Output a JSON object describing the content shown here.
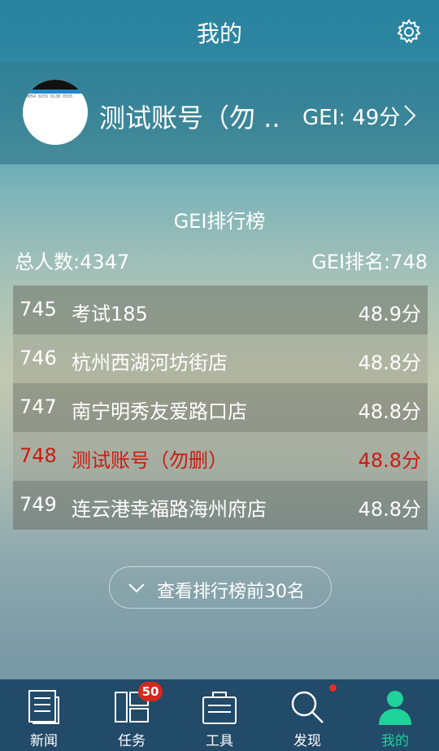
{
  "header": {
    "title": "我的",
    "settings_icon": "gear-icon"
  },
  "profile": {
    "name": "测试账号（勿 ..",
    "gei": "GEI: 49分",
    "avatar_text": "0054 0255 0138 0555"
  },
  "ranking": {
    "title": "GEI排行榜",
    "total": "总人数:4347",
    "my_rank": "GEI排名:748",
    "rows": [
      {
        "rank": "745",
        "name": "考试185",
        "score": "48.9分",
        "highlight": false
      },
      {
        "rank": "746",
        "name": "杭州西湖河坊街店",
        "score": "48.8分",
        "highlight": false
      },
      {
        "rank": "747",
        "name": "南宁明秀友爱路口店",
        "score": "48.8分",
        "highlight": false
      },
      {
        "rank": "748",
        "name": "测试账号（勿删）",
        "score": "48.8分",
        "highlight": true
      },
      {
        "rank": "749",
        "name": "连云港幸福路海州府店",
        "score": "48.8分",
        "highlight": false
      }
    ],
    "view_more": "查看排行榜前30名"
  },
  "tabbar": {
    "items": [
      {
        "label": "新闻",
        "icon": "news-icon"
      },
      {
        "label": "任务",
        "icon": "tasks-icon",
        "badge": "50"
      },
      {
        "label": "工具",
        "icon": "toolbox-icon"
      },
      {
        "label": "发现",
        "icon": "search-icon"
      },
      {
        "label": "我的",
        "icon": "user-icon",
        "active": true
      }
    ]
  },
  "colors": {
    "highlight": "#cc1a12",
    "active_tab": "#1ed29a",
    "tabbar_bg": "#224a69",
    "badge": "#d5281e"
  }
}
